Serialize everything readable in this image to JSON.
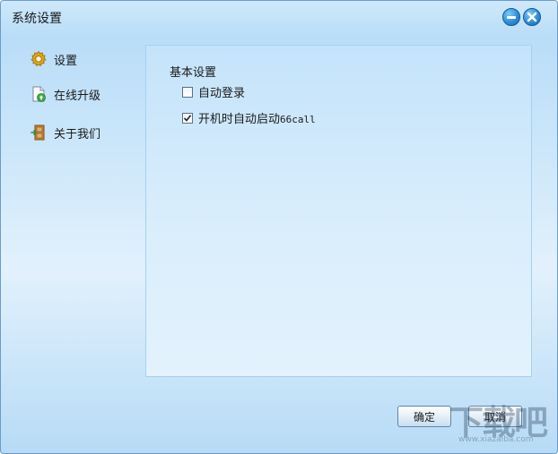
{
  "window": {
    "title": "系统设置"
  },
  "sidebar": {
    "items": [
      {
        "label": "设置",
        "icon": "gear-icon"
      },
      {
        "label": "在线升级",
        "icon": "upgrade-document-icon"
      },
      {
        "label": "关于我们",
        "icon": "door-icon"
      }
    ]
  },
  "content": {
    "section_title": "基本设置",
    "options": [
      {
        "label": "自动登录",
        "checked": false
      },
      {
        "label_prefix": "开机时自动启动",
        "label_suffix": "66call",
        "checked": true
      }
    ]
  },
  "buttons": {
    "ok": "确定",
    "cancel": "取消"
  },
  "watermark": {
    "main": "下载吧",
    "sub": "www.xiazaiba.com"
  },
  "colors": {
    "accent": "#2f8fd8",
    "content_bg": "#d8edfc"
  }
}
